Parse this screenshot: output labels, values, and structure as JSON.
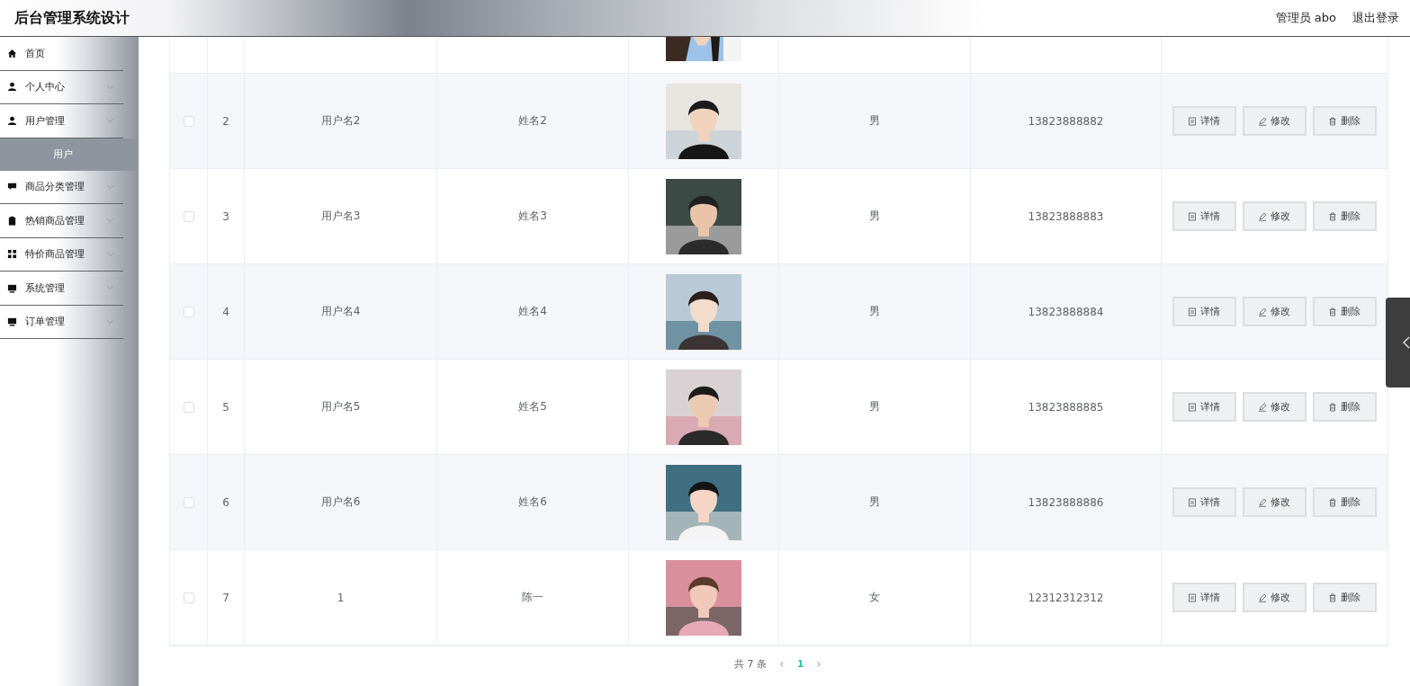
{
  "header": {
    "title": "后台管理系统设计",
    "user": "管理员 abo",
    "logout": "退出登录"
  },
  "sidebar": {
    "items": [
      {
        "label": "首页",
        "kind": "link"
      },
      {
        "label": "个人中心",
        "kind": "submenu"
      },
      {
        "label": "用户管理",
        "kind": "submenu",
        "children": [
          {
            "label": "用户",
            "selected": true
          }
        ]
      },
      {
        "label": "商品分类管理",
        "kind": "submenu"
      },
      {
        "label": "热销商品管理",
        "kind": "submenu"
      },
      {
        "label": "特价商品管理",
        "kind": "submenu"
      },
      {
        "label": "系统管理",
        "kind": "submenu"
      },
      {
        "label": "订单管理",
        "kind": "submenu"
      }
    ]
  },
  "table": {
    "rows": [
      {
        "checked": false,
        "index": "2",
        "username": "用户名2",
        "name": "姓名2",
        "sex": "男",
        "phone": "13823888882",
        "actions": [
          "详情",
          "修改",
          "删除"
        ]
      },
      {
        "checked": false,
        "index": "3",
        "username": "用户名3",
        "name": "姓名3",
        "sex": "男",
        "phone": "13823888883",
        "actions": [
          "详情",
          "修改",
          "删除"
        ]
      },
      {
        "checked": false,
        "index": "4",
        "username": "用户名4",
        "name": "姓名4",
        "sex": "男",
        "phone": "13823888884",
        "actions": [
          "详情",
          "修改",
          "删除"
        ]
      },
      {
        "checked": false,
        "index": "5",
        "username": "用户名5",
        "name": "姓名5",
        "sex": "男",
        "phone": "13823888885",
        "actions": [
          "详情",
          "修改",
          "删除"
        ]
      },
      {
        "checked": false,
        "index": "6",
        "username": "用户名6",
        "name": "姓名6",
        "sex": "男",
        "phone": "13823888886",
        "actions": [
          "详情",
          "修改",
          "删除"
        ]
      },
      {
        "checked": false,
        "index": "7",
        "username": "1",
        "name": "陈一",
        "sex": "女",
        "phone": "12312312312",
        "actions": [
          "详情",
          "修改",
          "删除"
        ]
      }
    ]
  },
  "pagination": {
    "total": "共 7 条",
    "prev": "‹",
    "pages": [
      {
        "label": "1",
        "selected": true
      }
    ],
    "next": "›"
  }
}
